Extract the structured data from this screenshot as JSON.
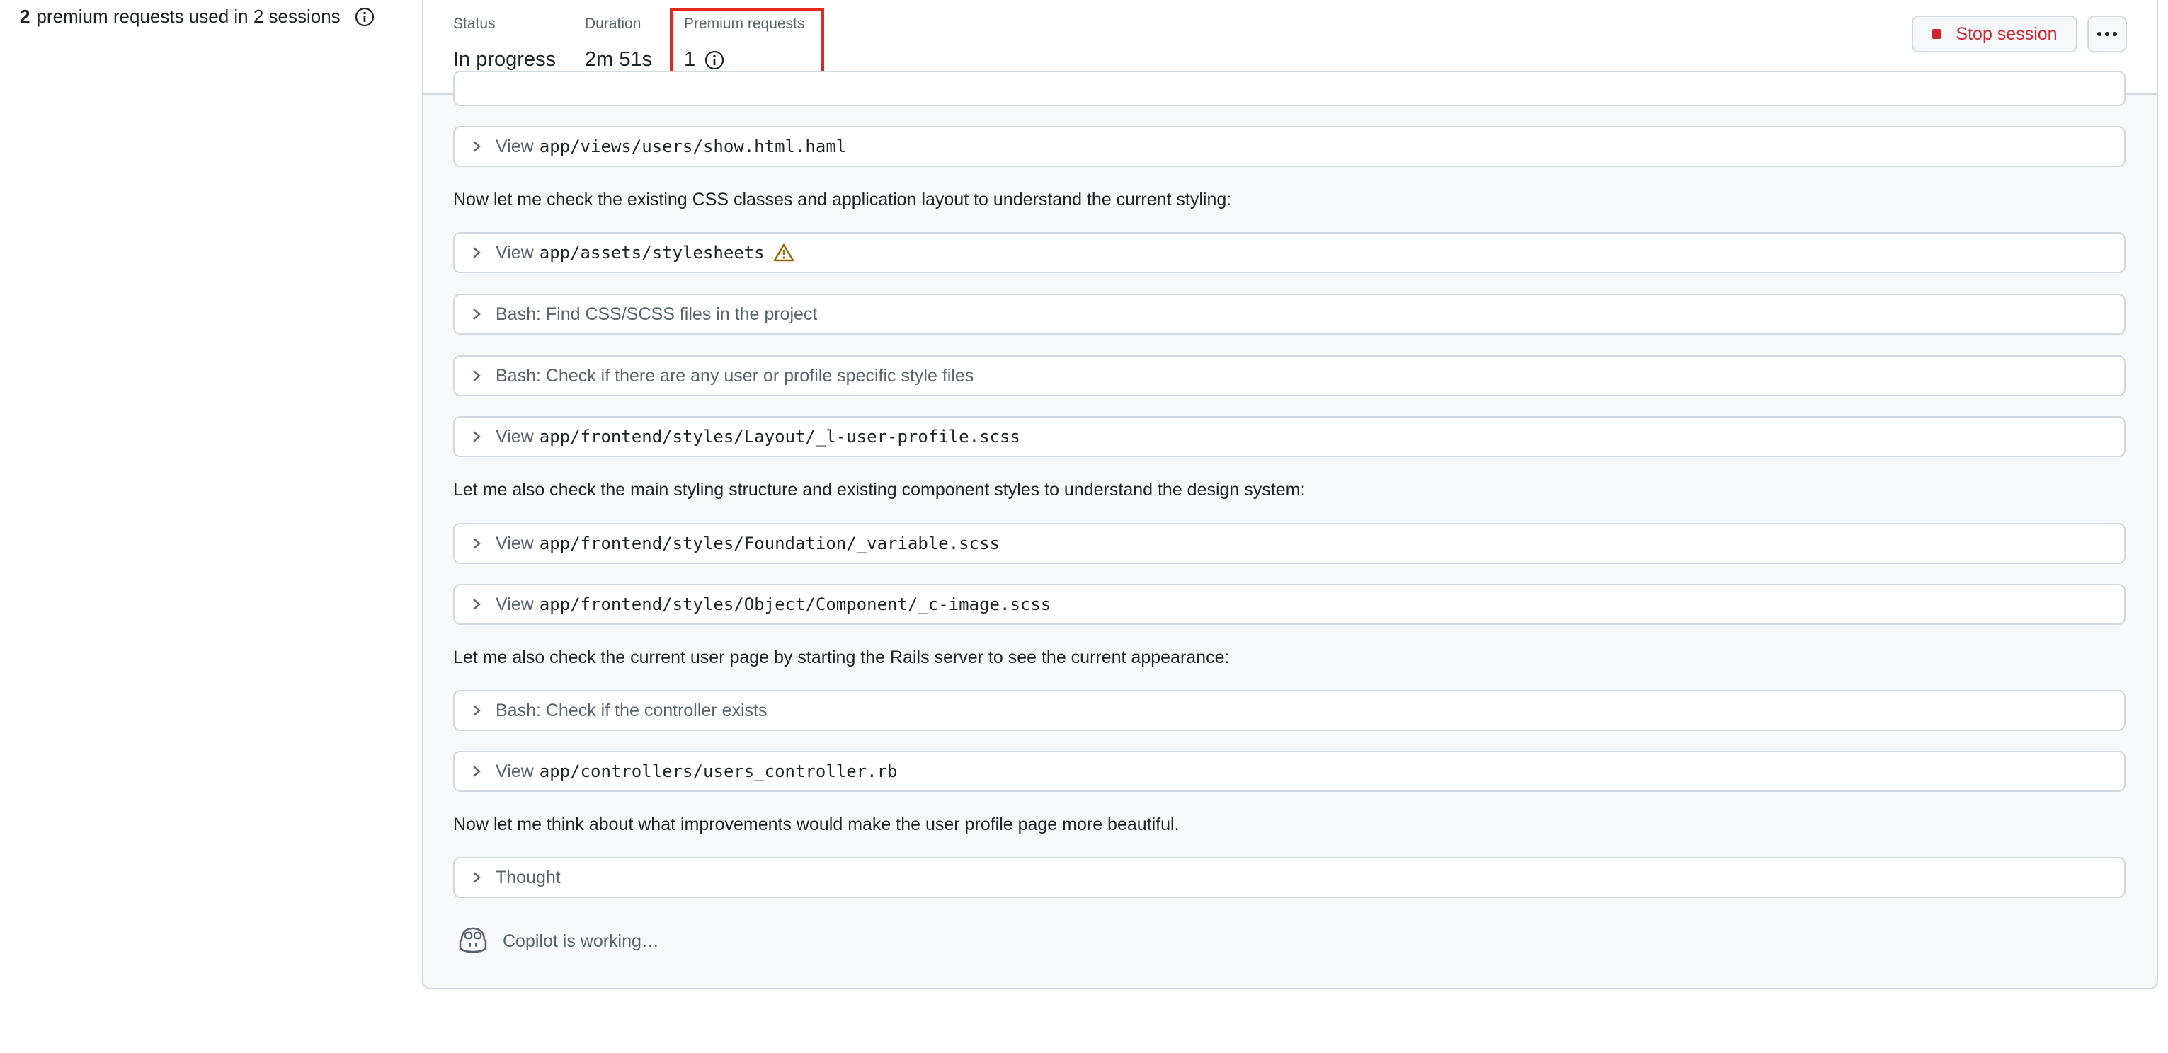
{
  "usage": {
    "count": "2",
    "text": "premium requests used in 2 sessions",
    "info_icon": "info-icon"
  },
  "header": {
    "status_label": "Status",
    "status_value": "In progress",
    "duration_label": "Duration",
    "duration_value": "2m 51s",
    "premium_label": "Premium requests",
    "premium_value": "1",
    "stop_label": "Stop session",
    "more_icon": "kebab-horizontal-icon",
    "highlight_color": "#e5271b"
  },
  "log": {
    "rows": [
      {
        "verb": "View",
        "path": "app/views/users/show.html.haml"
      },
      {
        "verb": "View",
        "path": "app/assets/stylesheets",
        "warning": true
      },
      {
        "verb": "Bash: Find CSS/SCSS files in the project",
        "path": ""
      },
      {
        "verb": "Bash: Check if there are any user or profile specific style files",
        "path": ""
      },
      {
        "verb": "View",
        "path": "app/frontend/styles/Layout/_l-user-profile.scss"
      },
      {
        "verb": "View",
        "path": "app/frontend/styles/Foundation/_variable.scss"
      },
      {
        "verb": "View",
        "path": "app/frontend/styles/Object/Component/_c-image.scss"
      },
      {
        "verb": "Bash: Check if the controller exists",
        "path": ""
      },
      {
        "verb": "View",
        "path": "app/controllers/users_controller.rb"
      },
      {
        "verb": "Thought",
        "path": ""
      }
    ],
    "paragraphs": [
      "Now let me check the existing CSS classes and application layout to understand the current styling:",
      "Let me also check the main styling structure and existing component styles to understand the design system:",
      "Let me also check the current user page by starting the Rails server to see the current appearance:",
      "Now let me think about what improvements would make the user profile page more beautiful."
    ],
    "working_text": "Copilot is working…",
    "working_icon": "copilot-icon"
  },
  "colors": {
    "danger": "#cf222e",
    "border": "#d1d9e0",
    "muted": "#59636e",
    "warning": "#9a6700"
  }
}
